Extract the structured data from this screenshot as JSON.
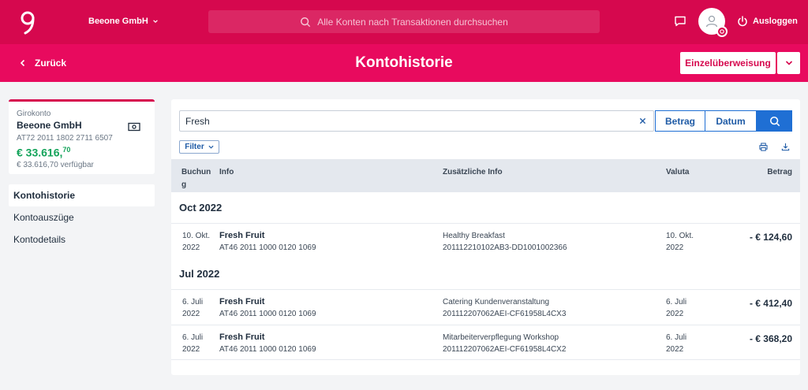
{
  "header": {
    "company": "Beeone GmbH",
    "search_placeholder": "Alle Konten nach Transaktionen durchsuchen",
    "logout_label": "Ausloggen"
  },
  "subheader": {
    "back_label": "Zurück",
    "title": "Kontohistorie",
    "transfer_label": "Einzelüberweisung"
  },
  "account": {
    "type": "Girokonto",
    "name": "Beeone GmbH",
    "iban": "AT72 2011 1802 2711 6507",
    "balance_main": "€ 33.616,",
    "balance_cents": "70",
    "available": "€ 33.616,70 verfügbar"
  },
  "sidebar": {
    "items": [
      {
        "label": "Kontohistorie"
      },
      {
        "label": "Kontoauszüge"
      },
      {
        "label": "Kontodetails"
      }
    ]
  },
  "search": {
    "value": "Fresh",
    "betrag_label": "Betrag",
    "datum_label": "Datum",
    "filter_label": "Filter"
  },
  "table": {
    "columns": {
      "buchung_1": "Buchun",
      "buchung_2": "g",
      "info": "Info",
      "extra": "Zusätzliche Info",
      "valuta": "Valuta",
      "betrag": "Betrag"
    },
    "groups": [
      {
        "label": "Oct 2022",
        "rows": [
          {
            "date1": "10. Okt.",
            "date2": "2022",
            "name": "Fresh Fruit",
            "iban": "AT46 2011 1000 0120 1069",
            "extra1": "Healthy Breakfast",
            "extra2": "201112210102AB3-DD1001002366",
            "valuta1": "10. Okt.",
            "valuta2": "2022",
            "amount": "- € 124,60"
          }
        ]
      },
      {
        "label": "Jul 2022",
        "rows": [
          {
            "date1": "6. Juli",
            "date2": "2022",
            "name": "Fresh Fruit",
            "iban": "AT46 2011 1000 0120 1069",
            "extra1": "Catering Kundenveranstaltung",
            "extra2": "201112207062AEI-CF61958L4CX3",
            "valuta1": "6. Juli",
            "valuta2": "2022",
            "amount": "- € 412,40"
          },
          {
            "date1": "6. Juli",
            "date2": "2022",
            "name": "Fresh Fruit",
            "iban": "AT46 2011 1000 0120 1069",
            "extra1": "Mitarbeiterverpflegung Workshop",
            "extra2": "201112207062AEI-CF61958L4CX2",
            "valuta1": "6. Juli",
            "valuta2": "2022",
            "amount": "- € 368,20"
          }
        ]
      }
    ]
  }
}
